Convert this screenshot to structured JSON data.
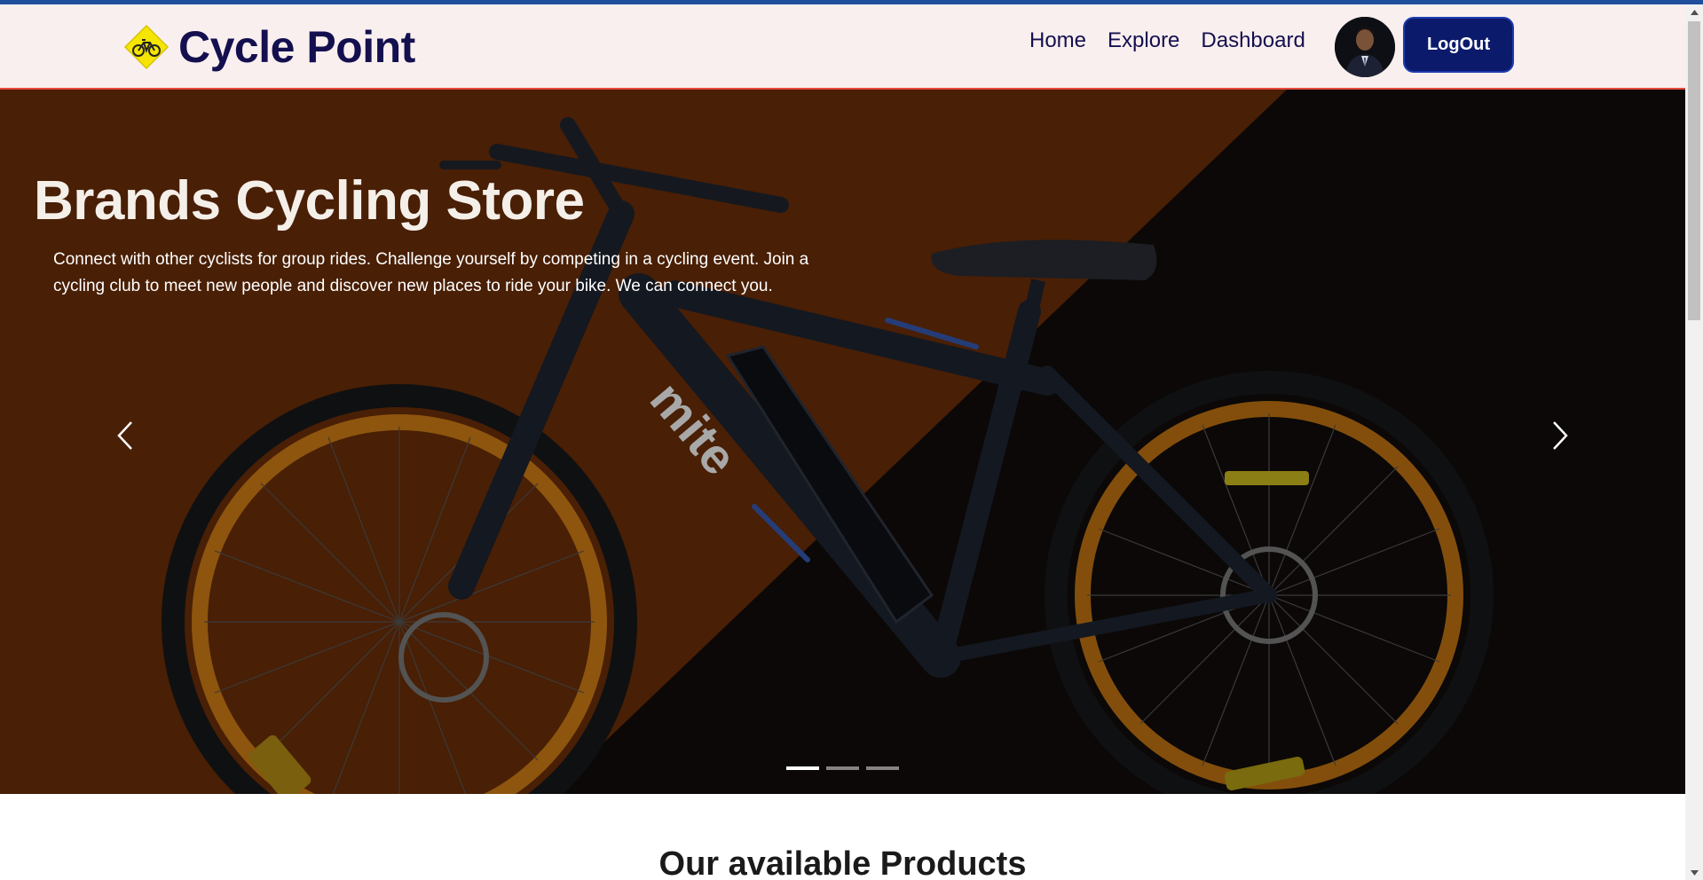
{
  "navbar": {
    "brand_name": "Cycle Point",
    "links": [
      {
        "label": "Home"
      },
      {
        "label": "Explore"
      },
      {
        "label": "Dashboard"
      }
    ],
    "logout_label": "LogOut"
  },
  "hero": {
    "title": "Brands Cycling Store",
    "text": "Connect with other cyclists for group rides. Challenge yourself by competing in a cycling event. Join a cycling club to meet new people and discover new places to ride your bike. We can connect you.",
    "slides": 3,
    "active_slide": 1
  },
  "products": {
    "heading": "Our available Products"
  },
  "colors": {
    "brand_navy": "#14104f",
    "logout_bg": "#0c1a6b",
    "navbar_bg": "#f9efee",
    "navbar_border": "#e64a3b",
    "hero_orange": "#5c2708",
    "top_strip": "#1f4e9c"
  },
  "icons": {
    "brand_logo": "bicycle-sign-icon",
    "prev": "chevron-left-icon",
    "next": "chevron-right-icon"
  }
}
